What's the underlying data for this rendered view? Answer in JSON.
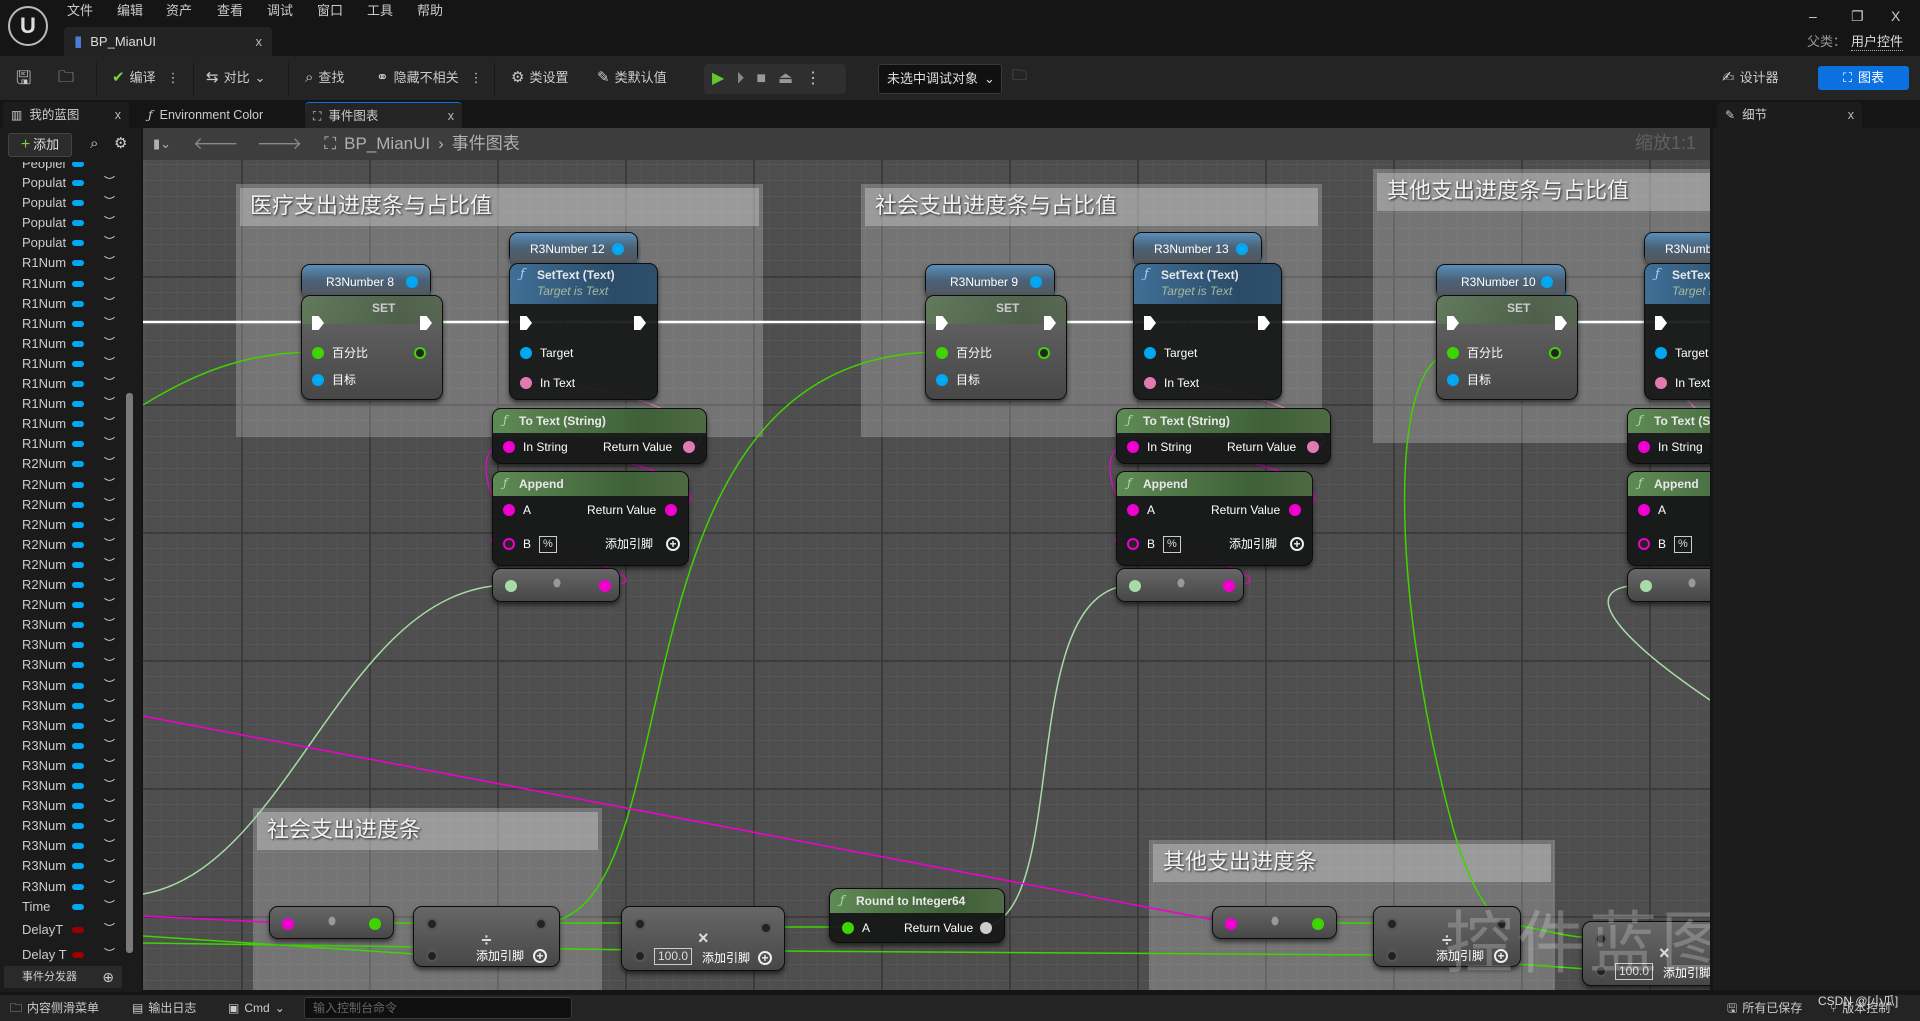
{
  "app": {
    "menu": [
      "文件",
      "编辑",
      "资产",
      "查看",
      "调试",
      "窗口",
      "工具",
      "帮助"
    ],
    "doc_tab": "BP_MianUI",
    "parent_label": "父类：",
    "parent_value": "用户控件",
    "window_controls": {
      "minimize": "–",
      "restore": "❐",
      "close": "X"
    }
  },
  "toolbar": {
    "compile": "编译",
    "diff": "对比",
    "find": "查找",
    "hide_unrelated": "隐藏不相关",
    "class_settings": "类设置",
    "class_defaults": "类默认值",
    "debug_target": "未选中调试对象",
    "designer": "设计器",
    "graph": "图表"
  },
  "panel_tabs": {
    "my_blueprint": "我的蓝图",
    "environment_color": "Environment Color",
    "event_graph": "事件图表",
    "details": "细节"
  },
  "my_blueprint": {
    "add": "添加",
    "variables": [
      {
        "name": "Peoplel",
        "color": "#00a8f4"
      },
      {
        "name": "Populat",
        "color": "#00a8f4"
      },
      {
        "name": "Populat",
        "color": "#00a8f4"
      },
      {
        "name": "Populat",
        "color": "#00a8f4"
      },
      {
        "name": "Populat",
        "color": "#00a8f4"
      },
      {
        "name": "R1Num",
        "color": "#00a8f4"
      },
      {
        "name": "R1Num",
        "color": "#00a8f4"
      },
      {
        "name": "R1Num",
        "color": "#00a8f4"
      },
      {
        "name": "R1Num",
        "color": "#00a8f4"
      },
      {
        "name": "R1Num",
        "color": "#00a8f4"
      },
      {
        "name": "R1Num",
        "color": "#00a8f4"
      },
      {
        "name": "R1Num",
        "color": "#00a8f4"
      },
      {
        "name": "R1Num",
        "color": "#00a8f4"
      },
      {
        "name": "R1Num",
        "color": "#00a8f4"
      },
      {
        "name": "R1Num",
        "color": "#00a8f4"
      },
      {
        "name": "R2Num",
        "color": "#00a8f4"
      },
      {
        "name": "R2Num",
        "color": "#00a8f4"
      },
      {
        "name": "R2Num",
        "color": "#00a8f4"
      },
      {
        "name": "R2Num",
        "color": "#00a8f4"
      },
      {
        "name": "R2Num",
        "color": "#00a8f4"
      },
      {
        "name": "R2Num",
        "color": "#00a8f4"
      },
      {
        "name": "R2Num",
        "color": "#00a8f4"
      },
      {
        "name": "R2Num",
        "color": "#00a8f4"
      },
      {
        "name": "R3Num",
        "color": "#00a8f4"
      },
      {
        "name": "R3Num",
        "color": "#00a8f4"
      },
      {
        "name": "R3Num",
        "color": "#00a8f4"
      },
      {
        "name": "R3Num",
        "color": "#00a8f4"
      },
      {
        "name": "R3Num",
        "color": "#00a8f4"
      },
      {
        "name": "R3Num",
        "color": "#00a8f4"
      },
      {
        "name": "R3Num",
        "color": "#00a8f4"
      },
      {
        "name": "R3Num",
        "color": "#00a8f4"
      },
      {
        "name": "R3Num",
        "color": "#00a8f4"
      },
      {
        "name": "R3Num",
        "color": "#00a8f4"
      },
      {
        "name": "R3Num",
        "color": "#00a8f4"
      },
      {
        "name": "R3Num",
        "color": "#00a8f4"
      },
      {
        "name": "R3Num",
        "color": "#00a8f4"
      },
      {
        "name": "R3Num",
        "color": "#00a8f4"
      },
      {
        "name": "Time",
        "color": "#00a8f4"
      },
      {
        "name": "DelayT",
        "color": "#9a0000"
      },
      {
        "name": "Delay T",
        "color": "#9a0000"
      }
    ],
    "event_dispatchers": "事件分发器"
  },
  "graph": {
    "breadcrumb": [
      "BP_MianUI",
      "事件图表"
    ],
    "zoom": "缩放1:1",
    "watermark": "控件蓝图",
    "comments": [
      "医疗支出进度条与占比值",
      "社会支出进度条与占比值",
      "其他支出进度条与占比值",
      "社会支出进度条",
      "其他支出进度条"
    ],
    "labels": {
      "set": "SET",
      "percent": "百分比",
      "target_cn": "目标",
      "settext_title": "SetText (Text)",
      "settext_sub": "Target is Text",
      "target": "Target",
      "in_text": "In Text",
      "totext_title": "To Text (String)",
      "in_string": "In String",
      "return_value": "Return Value",
      "append_title": "Append",
      "a": "A",
      "b": "B",
      "b_default": "%",
      "add_pin": "添加引脚",
      "divide": "÷",
      "multiply": "×",
      "multiply_default": "100.0",
      "round_title": "Round to Integer64"
    },
    "groups": [
      {
        "var": "R3Number 8",
        "text_target": "R3Number 12"
      },
      {
        "var": "R3Number 9",
        "text_target": "R3Number 13"
      },
      {
        "var": "R3Number 10",
        "text_target": "R3Numb"
      }
    ],
    "pin_colors": {
      "exec": "#ffffff",
      "object": "#00a8f4",
      "float": "#3ed400",
      "string": "#f000d0",
      "text": "#e07ab0",
      "float_light": "#a6dca6"
    }
  },
  "bottom": {
    "content_drawer": "内容侧滑菜单",
    "output_log": "输出日志",
    "cmd": "Cmd",
    "cmd_placeholder": "输入控制台命令",
    "all_saved": "所有已保存",
    "source_control": "版本控制",
    "watermark": "CSDN @[小瓜]"
  }
}
